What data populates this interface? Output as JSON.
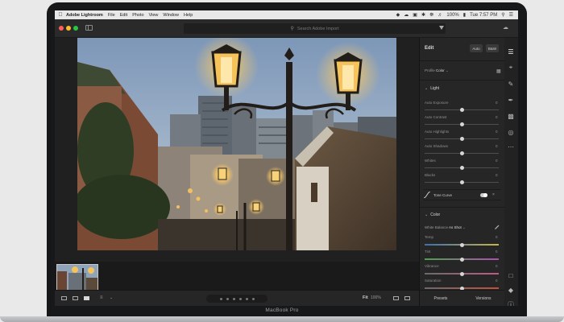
{
  "menubar": {
    "apple": "",
    "app_name": "Adobe Lightroom",
    "items": [
      "File",
      "Edit",
      "Photo",
      "View",
      "Window",
      "Help"
    ],
    "battery": "100%",
    "clock": "Tue 7:57 PM"
  },
  "titlebar": {
    "search_placeholder": "Search Adobe Import"
  },
  "filmstrip": {
    "thumbnails": 1
  },
  "bottombar": {
    "fit_label": "Fit",
    "zoom_label": "100%"
  },
  "edit_panel": {
    "title": "Edit",
    "auto_button": "Auto",
    "bw_button": "B&W",
    "profile_label": "Profile",
    "profile_value": "Color",
    "light_section": "Light",
    "light_sliders": [
      {
        "label": "Auto Exposure",
        "value": "0",
        "level": 0.5
      },
      {
        "label": "Auto Contrast",
        "value": "0",
        "level": 0.5
      },
      {
        "label": "Auto Highlights",
        "value": "0",
        "level": 0.5
      },
      {
        "label": "Auto Shadows",
        "value": "0",
        "level": 0.5
      },
      {
        "label": "Whites",
        "value": "0",
        "level": 0.5
      },
      {
        "label": "Blacks",
        "value": "0",
        "level": 0.5
      }
    ],
    "tone_curve_label": "Tone Curve",
    "color_section": "Color",
    "white_balance_label": "White Balance",
    "white_balance_value": "As Shot",
    "color_sliders": [
      {
        "label": "Temp",
        "value": "0",
        "level": 0.5
      },
      {
        "label": "Tint",
        "value": "0",
        "level": 0.5
      },
      {
        "label": "Vibrance",
        "value": "0",
        "level": 0.5
      },
      {
        "label": "Saturation",
        "value": "0",
        "level": 0.5
      }
    ],
    "presets_label": "Presets",
    "versions_label": "Versions"
  },
  "laptop": {
    "model": "MacBook Pro"
  },
  "colors": {
    "panel_bg": "#262626",
    "canvas_bg": "#202020",
    "menubar_bg": "#e8e8e8"
  },
  "icons": [
    "cloud-sync-icon",
    "edit-sliders-icon",
    "crop-icon",
    "healing-brush-icon",
    "brush-icon",
    "linear-gradient-icon",
    "radial-gradient-icon",
    "more-icon",
    "comment-icon",
    "tag-icon",
    "info-icon"
  ]
}
